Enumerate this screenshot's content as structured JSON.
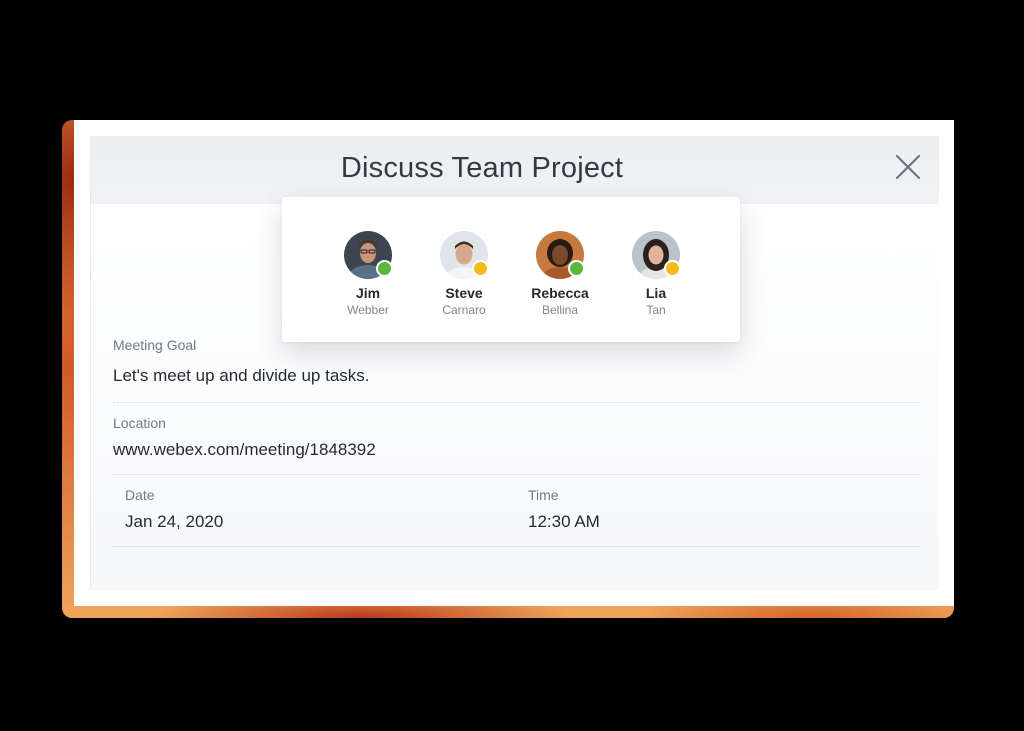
{
  "dialog": {
    "title": "Discuss Team Project",
    "close_icon": "close-icon"
  },
  "participants": [
    {
      "first": "Jim",
      "last": "Webber",
      "status": "online",
      "status_color": "#5cb83c"
    },
    {
      "first": "Steve",
      "last": "Carnaro",
      "status": "away",
      "status_color": "#f2bd1c"
    },
    {
      "first": "Rebecca",
      "last": "Bellina",
      "status": "online",
      "status_color": "#5cb83c"
    },
    {
      "first": "Lia",
      "last": "Tan",
      "status": "away",
      "status_color": "#f2bd1c"
    }
  ],
  "fields": {
    "goal_label": "Meeting Goal",
    "goal_value": "Let's meet up and divide up tasks.",
    "location_label": "Location",
    "location_value": "www.webex.com/meeting/1848392",
    "date_label": "Date",
    "date_value": "Jan 24, 2020",
    "time_label": "Time",
    "time_value": "12:30 AM"
  }
}
